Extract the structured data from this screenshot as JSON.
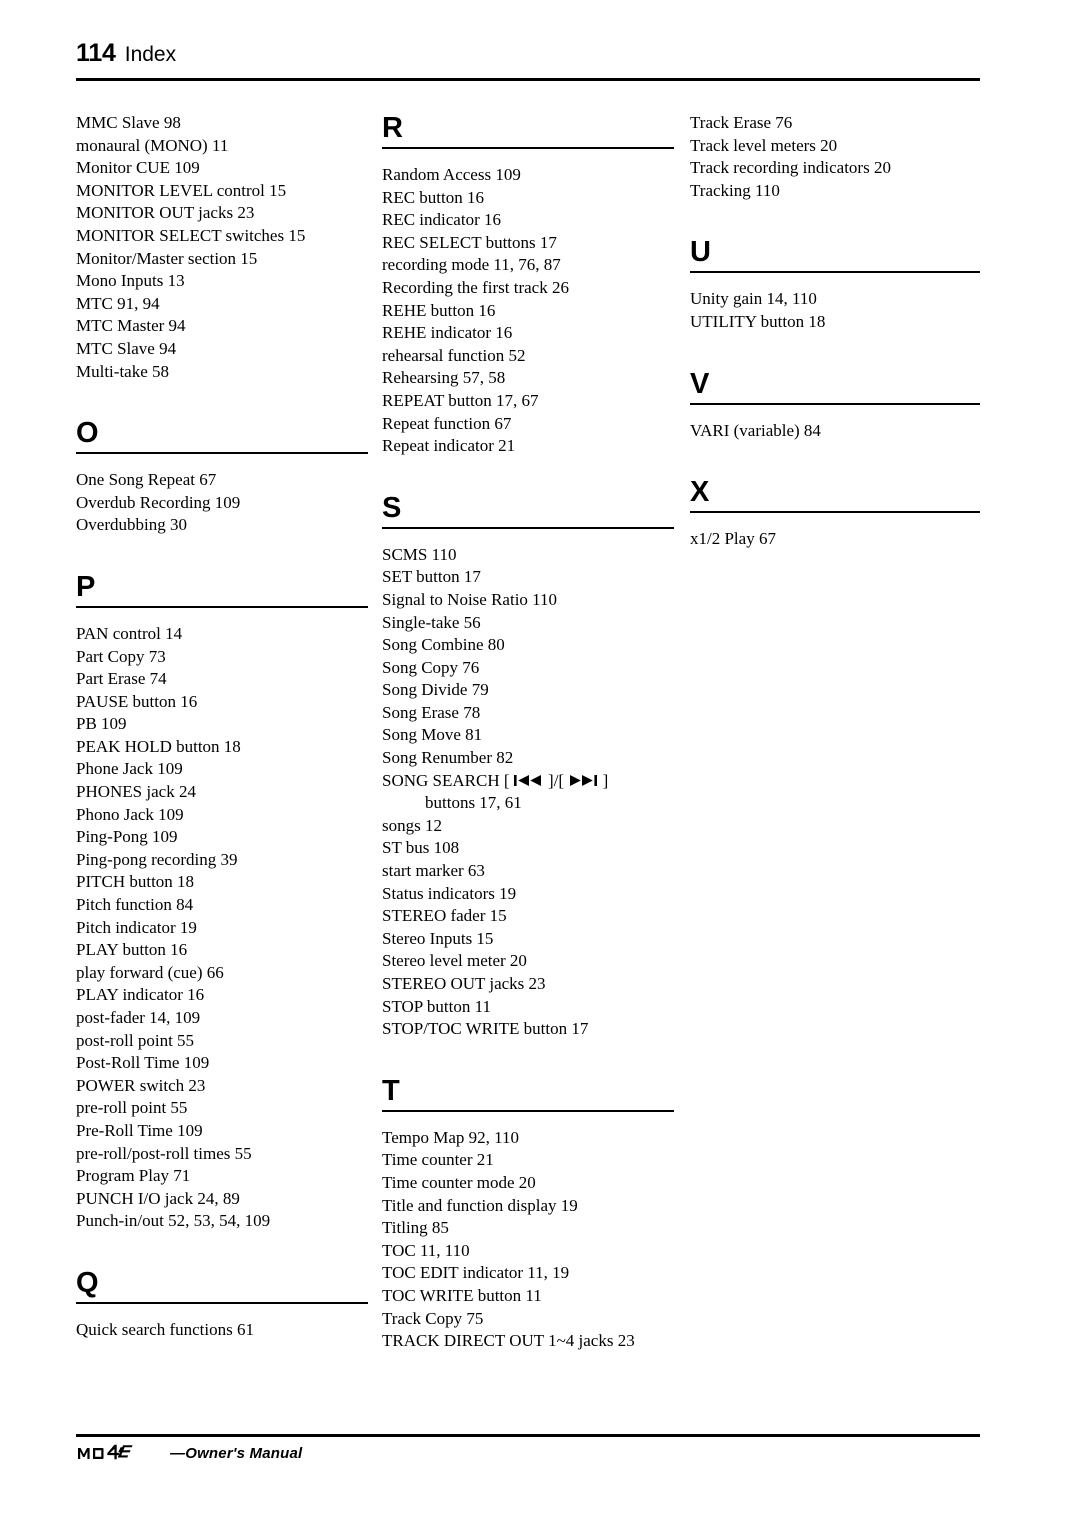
{
  "header": {
    "folio": "114",
    "title": "Index"
  },
  "columns": [
    {
      "id": "column-1",
      "blocks": [
        {
          "type": "entries",
          "items": [
            "MMC Slave 98",
            "monaural (MONO) 11",
            "Monitor CUE 109",
            "MONITOR LEVEL control 15",
            "MONITOR OUT jacks 23",
            "MONITOR SELECT switches 15",
            "Monitor/Master section 15",
            "Mono Inputs 13",
            "MTC 91, 94",
            "MTC Master 94",
            "MTC Slave 94",
            "Multi-take 58"
          ]
        },
        {
          "type": "section",
          "letter": "O",
          "items": [
            "One Song Repeat 67",
            "Overdub Recording 109",
            "Overdubbing 30"
          ]
        },
        {
          "type": "section",
          "letter": "P",
          "items": [
            "PAN control 14",
            "Part Copy 73",
            "Part Erase 74",
            "PAUSE button 16",
            "PB 109",
            "PEAK HOLD button 18",
            "Phone Jack 109",
            "PHONES jack 24",
            "Phono Jack 109",
            "Ping-Pong 109",
            "Ping-pong recording 39",
            "PITCH button 18",
            "Pitch function 84",
            "Pitch indicator 19",
            "PLAY button 16",
            "play forward (cue) 66",
            "PLAY indicator 16",
            "post-fader 14, 109",
            "post-roll point 55",
            "Post-Roll Time 109",
            "POWER switch 23",
            "pre-roll point 55",
            "Pre-Roll Time 109",
            "pre-roll/post-roll times 55",
            "Program Play 71",
            "PUNCH I/O jack 24, 89",
            "Punch-in/out 52, 53, 54, 109"
          ]
        },
        {
          "type": "section",
          "letter": "Q",
          "items": [
            "Quick search functions 61"
          ]
        }
      ]
    },
    {
      "id": "column-2",
      "blocks": [
        {
          "type": "section",
          "letter": "R",
          "items": [
            "Random Access 109",
            "REC button 16",
            "REC indicator 16",
            "REC SELECT buttons 17",
            "recording mode 11, 76, 87",
            "Recording the first track 26",
            "REHE button 16",
            "REHE indicator 16",
            "rehearsal function 52",
            "Rehearsing 57, 58",
            "REPEAT button 17, 67",
            "Repeat function 67",
            "Repeat indicator 21"
          ]
        },
        {
          "type": "section",
          "letter": "S",
          "items": [
            "SCMS 110",
            "SET button 17",
            "Signal to Noise Ratio 110",
            "Single-take 56",
            "Song Combine 80",
            "Song Copy 76",
            "Song Divide 79",
            "Song Erase 78",
            "Song Move 81",
            "Song Renumber 82",
            "__SONG_SEARCH__",
            "songs 12",
            "ST bus 108",
            "start marker 63",
            "Status indicators 19",
            "STEREO fader 15",
            "Stereo Inputs 15",
            "Stereo level meter 20",
            "STEREO OUT jacks 23",
            "STOP button 11",
            "STOP/TOC WRITE button 17"
          ],
          "song_search": {
            "prefix": "SONG SEARCH [ ",
            "middle": " ]/[ ",
            "suffix": " ]",
            "continuation": "buttons 17, 61",
            "icon_prev": "skip-backward-icon",
            "icon_next": "skip-forward-icon"
          }
        },
        {
          "type": "section",
          "letter": "T",
          "items": [
            "Tempo Map 92, 110",
            "Time counter 21",
            "Time counter mode 20",
            "Title and function display 19",
            "Titling 85",
            "TOC 11, 110",
            "TOC EDIT indicator 11, 19",
            "TOC WRITE button 11",
            "Track Copy 75",
            "TRACK DIRECT OUT 1~4 jacks 23"
          ]
        }
      ]
    },
    {
      "id": "column-3",
      "blocks": [
        {
          "type": "entries",
          "items": [
            "Track Erase 76",
            "Track level meters 20",
            "Track recording indicators 20",
            "Tracking 110"
          ]
        },
        {
          "type": "section",
          "letter": "U",
          "items": [
            "Unity gain 14, 110",
            "UTILITY button 18"
          ]
        },
        {
          "type": "section",
          "letter": "V",
          "items": [
            "VARI (variable) 84"
          ]
        },
        {
          "type": "section",
          "letter": "X",
          "items": [
            "x1/2 Play 67"
          ]
        }
      ]
    }
  ],
  "footer": {
    "logo": "MD4S",
    "text": "—Owner's Manual"
  }
}
